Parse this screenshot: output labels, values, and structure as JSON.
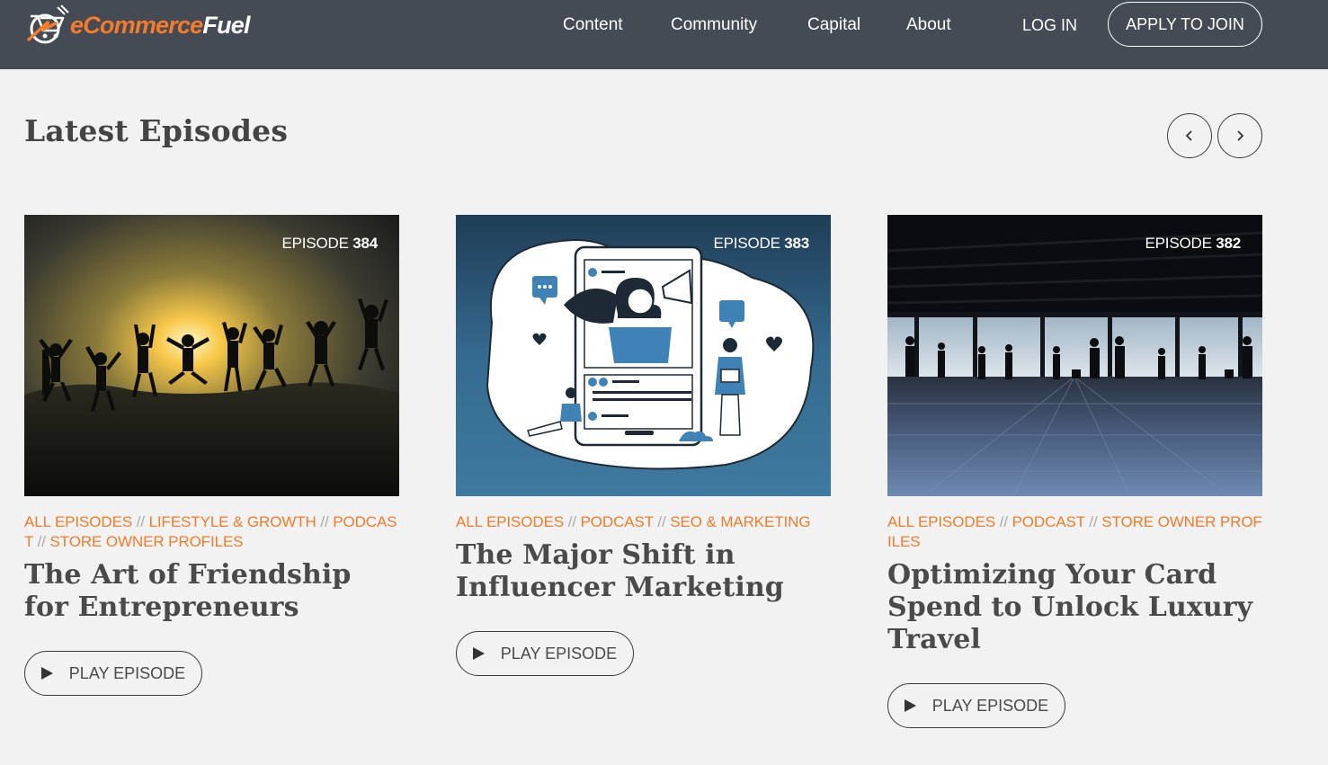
{
  "brand": {
    "logo_e": "e",
    "logo_commerce": "Commerce",
    "logo_fuel": "Fuel",
    "colors": {
      "accent": "#f47b2a",
      "nav_bg": "#454b54",
      "page_bg": "#f2f2f2"
    }
  },
  "nav": {
    "links": [
      "Content",
      "Community",
      "Capital",
      "About"
    ],
    "login": "LOG IN",
    "apply": "APPLY TO JOIN"
  },
  "section": {
    "title": "Latest Episodes",
    "prev_icon": "chevron-left-icon",
    "next_icon": "chevron-right-icon"
  },
  "episodes": [
    {
      "label_prefix": "EPISODE ",
      "number": "384",
      "categories": [
        "ALL EPISODES",
        "LIFESTYLE & GROWTH",
        "PODCAST",
        "STORE OWNER PROFILES"
      ],
      "title": "The Art of Friendship for Entrepreneurs",
      "play_label": "PLAY EPISODE"
    },
    {
      "label_prefix": "EPISODE ",
      "number": "383",
      "categories": [
        "ALL EPISODES",
        "PODCAST",
        "SEO & MARKETING"
      ],
      "title": "The Major Shift in Influencer Marketing",
      "play_label": "PLAY EPISODE"
    },
    {
      "label_prefix": "EPISODE ",
      "number": "382",
      "categories": [
        "ALL EPISODES",
        "PODCAST",
        "STORE OWNER PROFILES"
      ],
      "title": "Optimizing Your Card Spend to Unlock Luxury Travel",
      "play_label": "PLAY EPISODE"
    }
  ],
  "separator": "//"
}
